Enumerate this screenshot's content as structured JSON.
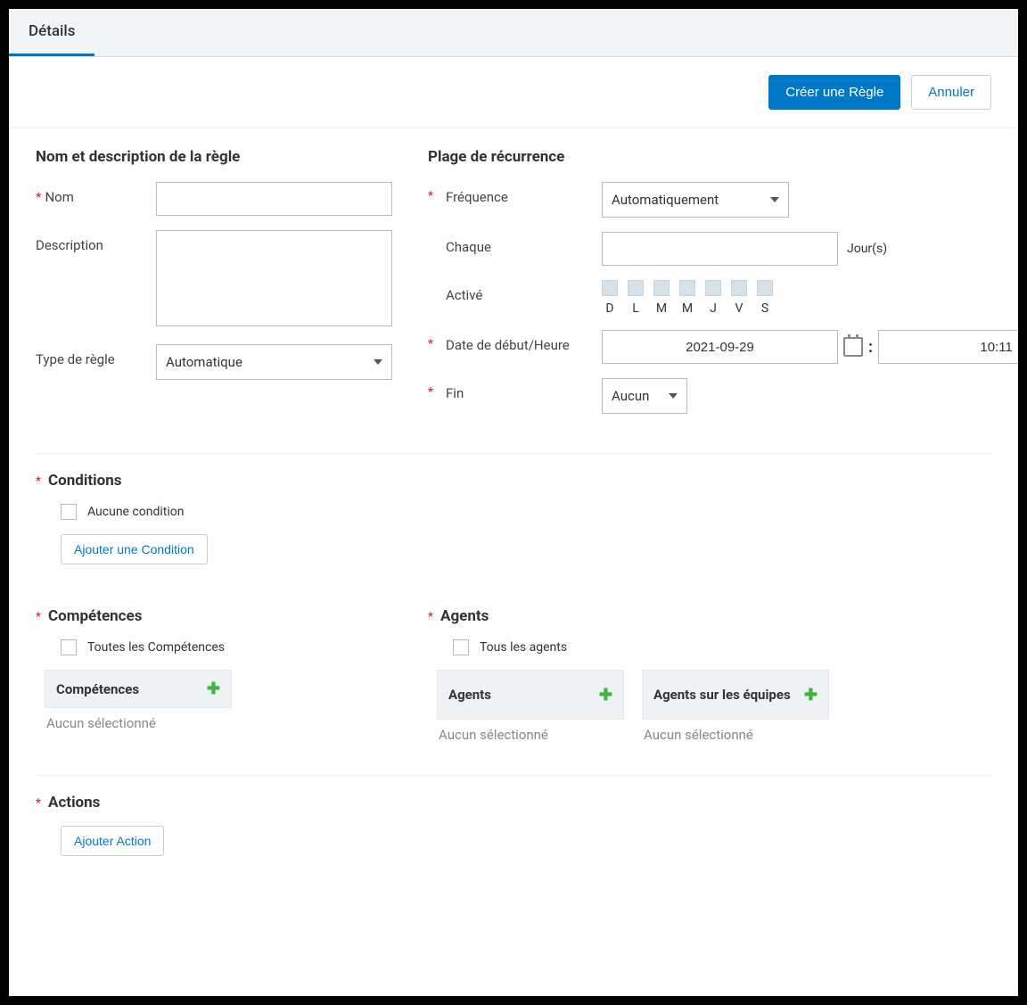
{
  "tabs": {
    "details": "Détails"
  },
  "buttons": {
    "create": "Créer une Règle",
    "cancel": "Annuler",
    "addCondition": "Ajouter une Condition",
    "addAction": "Ajouter Action"
  },
  "sections": {
    "nameDesc": "Nom et description de la règle",
    "recurrence": "Plage de récurrence",
    "conditions": "Conditions",
    "skills": "Compétences",
    "agents": "Agents",
    "actions": "Actions"
  },
  "labels": {
    "name": "Nom",
    "description": "Description",
    "ruleType": "Type de règle",
    "frequency": "Fréquence",
    "every": "Chaque",
    "everySuffix": "Jour(s)",
    "enabled": "Activé",
    "startDate": "Date de début/Heure",
    "end": "Fin",
    "noCondition": "Aucune condition",
    "allSkills": "Toutes les Compétences",
    "allAgents": "Tous les agents",
    "skillsBox": "Compétences",
    "agentsBox": "Agents",
    "teamsBox": "Agents sur les équipes",
    "noneSelected": "Aucun sélectionné"
  },
  "values": {
    "name": "",
    "description": "",
    "ruleType": "Automatique",
    "frequency": "Automatiquement",
    "every": "",
    "startDate": "2021-09-29",
    "startTime": "10:11",
    "end": "Aucun"
  },
  "days": [
    "D",
    "L",
    "M",
    "M",
    "J",
    "V",
    "S"
  ]
}
